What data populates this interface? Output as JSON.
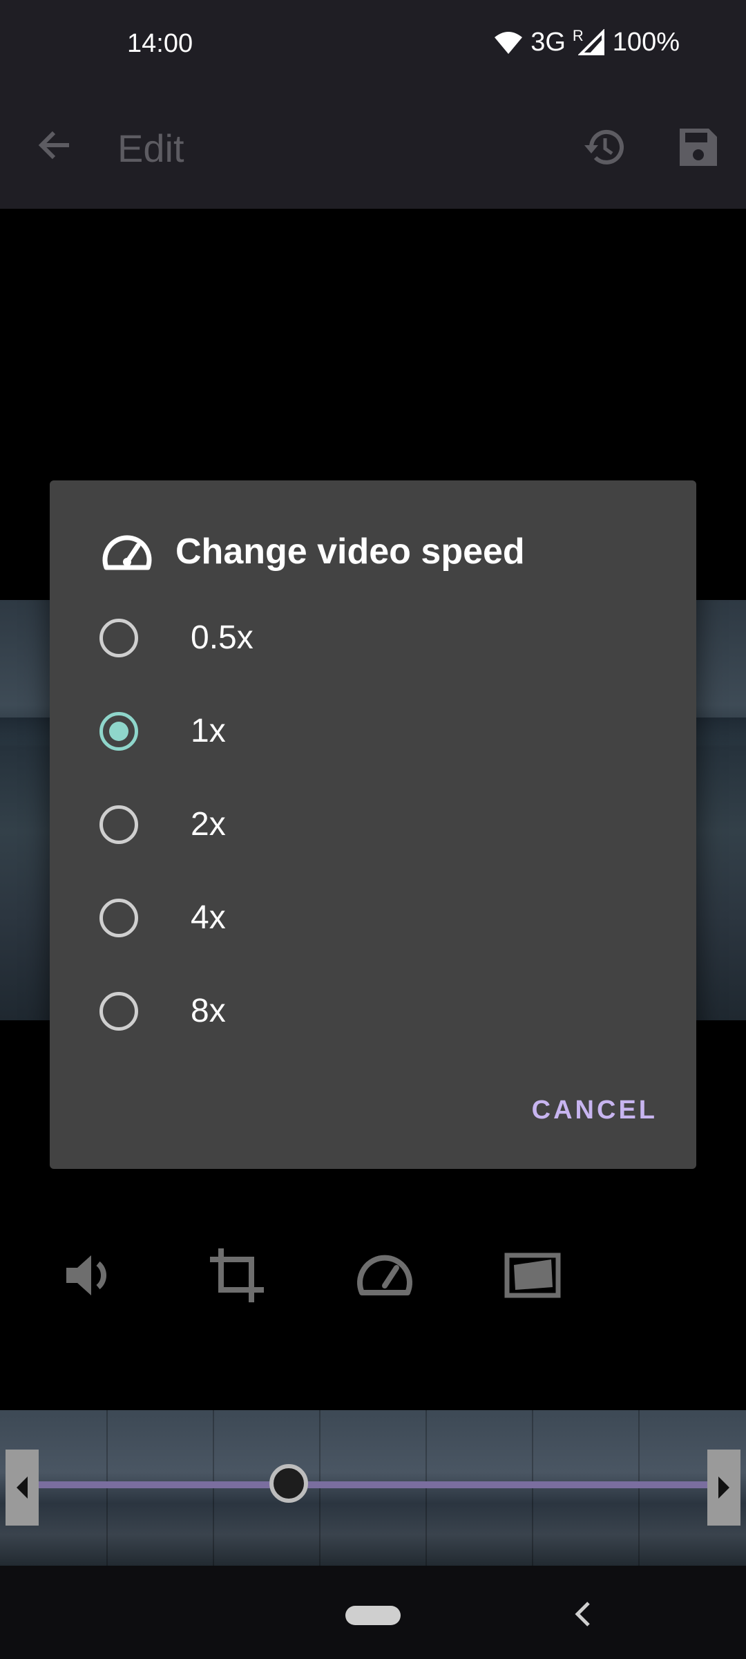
{
  "status_bar": {
    "time": "14:00",
    "network": "3G",
    "roaming": "R",
    "battery": "100%"
  },
  "app_bar": {
    "title": "Edit",
    "back_icon": "arrow-back-icon",
    "history_icon": "history-icon",
    "save_icon": "save-icon"
  },
  "dialog": {
    "title": "Change video speed",
    "icon": "speedometer-icon",
    "options": [
      {
        "label": "0.5x",
        "selected": false
      },
      {
        "label": "1x",
        "selected": true
      },
      {
        "label": "2x",
        "selected": false
      },
      {
        "label": "4x",
        "selected": false
      },
      {
        "label": "8x",
        "selected": false
      }
    ],
    "cancel_label": "CANCEL"
  },
  "toolbar": {
    "tools": [
      "volume-icon",
      "crop-icon",
      "speedometer-icon",
      "rotate-frame-icon"
    ]
  },
  "colors": {
    "accent_radio": "#8fd6cb",
    "accent_button": "#c8b5f0",
    "dialog_bg": "#434343",
    "bar_bg": "#1f1e24"
  }
}
